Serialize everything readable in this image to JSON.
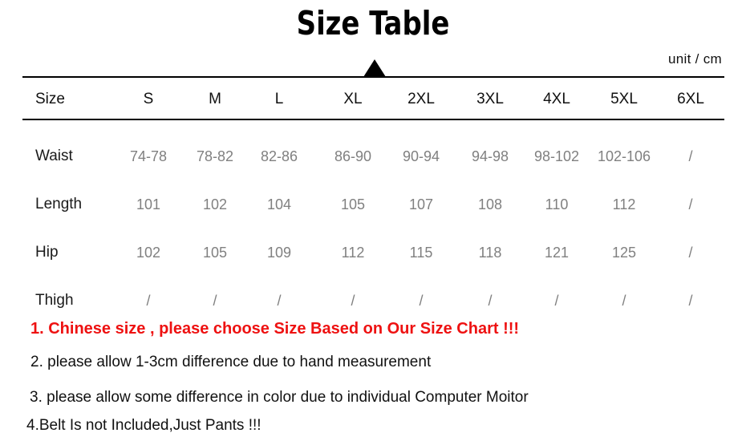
{
  "title": "Size Table",
  "unit_label": "unit / cm",
  "colors": {
    "rule": "#000000",
    "title": "#000000",
    "row_label": "#1a1a1a",
    "value": "#808080",
    "note_highlight": "#ee1111",
    "note": "#111111"
  },
  "table": {
    "corner_label": "Size",
    "columns": [
      "S",
      "M",
      "L",
      "XL",
      "2XL",
      "3XL",
      "4XL",
      "5XL",
      "6XL"
    ],
    "column_centers": [
      185,
      268,
      348,
      440,
      525,
      611,
      694,
      778,
      861
    ],
    "rows": [
      {
        "label": "Waist",
        "values": [
          "74-78",
          "78-82",
          "82-86",
          "86-90",
          "90-94",
          "94-98",
          "98-102",
          "102-106",
          "/"
        ]
      },
      {
        "label": "Length",
        "values": [
          "101",
          "102",
          "104",
          "105",
          "107",
          "108",
          "110",
          "112",
          "/"
        ]
      },
      {
        "label": "Hip",
        "values": [
          "102",
          "105",
          "109",
          "112",
          "115",
          "118",
          "121",
          "125",
          "/"
        ]
      },
      {
        "label": "Thigh",
        "values": [
          "/",
          "/",
          "/",
          "/",
          "/",
          "/",
          "/",
          "/",
          "/"
        ]
      }
    ]
  },
  "notes": [
    "1. Chinese size , please choose Size Based on Our Size Chart !!!",
    "2. please allow 1-3cm difference due to hand measurement",
    "3. please allow some difference in color due to individual Computer Moitor",
    "4.Belt Is not Included,Just Pants !!!"
  ]
}
